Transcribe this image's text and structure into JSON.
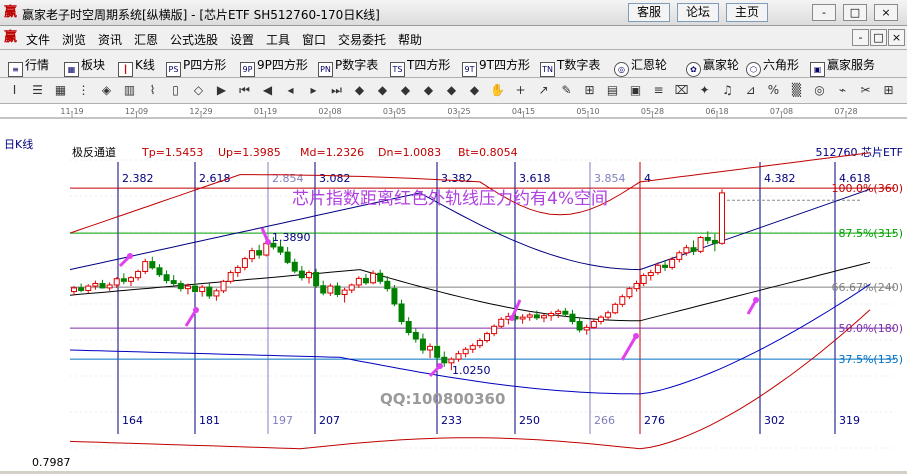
{
  "window": {
    "title": "赢家老子时空周期系统[纵横版] - [芯片ETF  SH512760-170日K线]",
    "buttons": [
      "客服",
      "论坛",
      "主页"
    ],
    "controls": [
      "-",
      "□",
      "×"
    ]
  },
  "menu": {
    "items": [
      "文件",
      "浏览",
      "资讯",
      "汇恩",
      "公式选股",
      "设置",
      "工具",
      "窗口",
      "交易委托",
      "帮助"
    ]
  },
  "toolbar1": {
    "items": [
      {
        "icon": "list-icon",
        "label": "行情"
      },
      {
        "icon": "blocks-icon",
        "label": "板块"
      },
      {
        "icon": "kline-icon",
        "label": "K线"
      },
      {
        "icon": "p-square-icon",
        "label": "P四方形"
      },
      {
        "icon": "9p-square-icon",
        "label": "9P四方形"
      },
      {
        "icon": "p-digit-icon",
        "label": "P数字表"
      },
      {
        "icon": "t-square-icon",
        "label": "T四方形"
      },
      {
        "icon": "9t-square-icon",
        "label": "9T四方形"
      },
      {
        "icon": "t-digit-icon",
        "label": "T数字表"
      },
      {
        "icon": "huien-wheel-icon",
        "label": "汇恩轮"
      },
      {
        "icon": "winner-wheel-icon",
        "label": "赢家轮"
      },
      {
        "icon": "hexagon-icon",
        "label": "六角形"
      },
      {
        "icon": "service-icon",
        "label": "赢家服务"
      }
    ]
  },
  "toolbar2": {
    "glyphs": [
      "Ⅰ",
      "☰",
      "▦",
      "⋮",
      "◈",
      "▥",
      "⌇",
      "▯",
      "◇",
      "▶",
      "⏮",
      "◀",
      "◂",
      "▸",
      "⏭",
      "◆",
      "◆",
      "◆",
      "◆",
      "◆",
      "◆",
      "✋",
      "+",
      "↗",
      "✎",
      "⊞",
      "▤",
      "▣",
      "≡",
      "⌧",
      "✦",
      "♫",
      "⊿",
      "%",
      "▒",
      "◎",
      "⌁",
      "✂",
      "⊞"
    ]
  },
  "chart_data": {
    "type": "candlestick",
    "panel_label": "日K线",
    "indicator_name": "极反通道",
    "stats": [
      {
        "label": "Tp",
        "value": "1.5453"
      },
      {
        "label": "Up",
        "value": "1.3985"
      },
      {
        "label": "Md",
        "value": "1.2326"
      },
      {
        "label": "Dn",
        "value": "1.0083"
      },
      {
        "label": "Bt",
        "value": "0.8054"
      }
    ],
    "symbol": "512760  芯片ETF",
    "date_ticks": [
      "11-19",
      "12-09",
      "12-29",
      "01-19",
      "02-08",
      "03-05",
      "03-25",
      "04-15",
      "05-10",
      "05-28",
      "06-18",
      "07-08",
      "07-28"
    ],
    "fib_top": [
      "2.382",
      "2.618",
      "2.854",
      "3.082",
      "3.382",
      "3.618",
      "3.854",
      "4",
      "4.382",
      "4.618"
    ],
    "cycle_bottom": [
      "164",
      "181",
      "197",
      "207",
      "233",
      "250",
      "266",
      "276",
      "302",
      "319"
    ],
    "levels": [
      {
        "label": "100.0%(360)",
        "price": 1.523,
        "color": "#c00000"
      },
      {
        "label": "87.5%(315)",
        "price": 1.4,
        "color": "#00a000"
      },
      {
        "label": "66.67%(240)",
        "price": 1.252,
        "color": "#808080"
      },
      {
        "label": "50.0%(180)",
        "price": 1.14,
        "color": "#7b2fa8"
      },
      {
        "label": "37.5%(135)",
        "price": 1.055,
        "color": "#0070c0"
      }
    ],
    "annotation": "芯片指数距离红色外轨线压力约有4%空间",
    "annotations_price": [
      {
        "text": "1.3890",
        "price": 1.389
      },
      {
        "text": "1.0250",
        "price": 1.025
      }
    ],
    "bottom_price": "0.7987",
    "watermark_contact": "QQ:100800360",
    "price_range": [
      0.79,
      1.6
    ],
    "candles": [
      [
        1.24,
        1.255,
        1.23,
        1.25
      ],
      [
        1.25,
        1.262,
        1.238,
        1.243
      ],
      [
        1.243,
        1.26,
        1.235,
        1.255
      ],
      [
        1.255,
        1.27,
        1.245,
        1.262
      ],
      [
        1.262,
        1.272,
        1.248,
        1.25
      ],
      [
        1.25,
        1.265,
        1.242,
        1.258
      ],
      [
        1.258,
        1.28,
        1.25,
        1.275
      ],
      [
        1.275,
        1.29,
        1.26,
        1.268
      ],
      [
        1.268,
        1.282,
        1.255,
        1.278
      ],
      [
        1.278,
        1.3,
        1.27,
        1.295
      ],
      [
        1.295,
        1.33,
        1.288,
        1.322
      ],
      [
        1.322,
        1.335,
        1.3,
        1.305
      ],
      [
        1.305,
        1.315,
        1.28,
        1.286
      ],
      [
        1.286,
        1.298,
        1.262,
        1.27
      ],
      [
        1.27,
        1.285,
        1.255,
        1.262
      ],
      [
        1.262,
        1.27,
        1.24,
        1.248
      ],
      [
        1.248,
        1.262,
        1.232,
        1.255
      ],
      [
        1.255,
        1.265,
        1.236,
        1.24
      ],
      [
        1.24,
        1.258,
        1.226,
        1.252
      ],
      [
        1.252,
        1.262,
        1.22,
        1.228
      ],
      [
        1.228,
        1.248,
        1.215,
        1.242
      ],
      [
        1.242,
        1.272,
        1.236,
        1.268
      ],
      [
        1.268,
        1.298,
        1.262,
        1.292
      ],
      [
        1.292,
        1.312,
        1.28,
        1.306
      ],
      [
        1.306,
        1.335,
        1.298,
        1.33
      ],
      [
        1.33,
        1.36,
        1.32,
        1.352
      ],
      [
        1.352,
        1.368,
        1.33,
        1.34
      ],
      [
        1.34,
        1.378,
        1.336,
        1.372
      ],
      [
        1.372,
        1.389,
        1.355,
        1.362
      ],
      [
        1.362,
        1.38,
        1.34,
        1.348
      ],
      [
        1.348,
        1.362,
        1.315,
        1.32
      ],
      [
        1.32,
        1.33,
        1.29,
        1.296
      ],
      [
        1.296,
        1.31,
        1.27,
        1.278
      ],
      [
        1.278,
        1.298,
        1.262,
        1.292
      ],
      [
        1.292,
        1.302,
        1.25,
        1.256
      ],
      [
        1.256,
        1.27,
        1.23,
        1.236
      ],
      [
        1.236,
        1.262,
        1.228,
        1.255
      ],
      [
        1.255,
        1.265,
        1.225,
        1.232
      ],
      [
        1.232,
        1.25,
        1.21,
        1.244
      ],
      [
        1.244,
        1.262,
        1.236,
        1.258
      ],
      [
        1.258,
        1.282,
        1.25,
        1.276
      ],
      [
        1.276,
        1.288,
        1.258,
        1.264
      ],
      [
        1.264,
        1.298,
        1.26,
        1.29
      ],
      [
        1.29,
        1.3,
        1.26,
        1.268
      ],
      [
        1.268,
        1.282,
        1.24,
        1.248
      ],
      [
        1.248,
        1.258,
        1.2,
        1.206
      ],
      [
        1.206,
        1.218,
        1.15,
        1.158
      ],
      [
        1.158,
        1.17,
        1.12,
        1.128
      ],
      [
        1.128,
        1.14,
        1.1,
        1.11
      ],
      [
        1.11,
        1.125,
        1.07,
        1.08
      ],
      [
        1.08,
        1.098,
        1.058,
        1.09
      ],
      [
        1.09,
        1.098,
        1.05,
        1.06
      ],
      [
        1.06,
        1.076,
        1.034,
        1.045
      ],
      [
        1.045,
        1.06,
        1.025,
        1.055
      ],
      [
        1.055,
        1.078,
        1.048,
        1.07
      ],
      [
        1.07,
        1.088,
        1.06,
        1.082
      ],
      [
        1.082,
        1.098,
        1.072,
        1.092
      ],
      [
        1.092,
        1.112,
        1.085,
        1.106
      ],
      [
        1.106,
        1.13,
        1.1,
        1.125
      ],
      [
        1.125,
        1.15,
        1.118,
        1.145
      ],
      [
        1.145,
        1.17,
        1.14,
        1.164
      ],
      [
        1.164,
        1.182,
        1.15,
        1.172
      ],
      [
        1.172,
        1.185,
        1.158,
        1.165
      ],
      [
        1.165,
        1.178,
        1.152,
        1.17
      ],
      [
        1.17,
        1.182,
        1.16,
        1.176
      ],
      [
        1.176,
        1.188,
        1.162,
        1.168
      ],
      [
        1.168,
        1.18,
        1.156,
        1.174
      ],
      [
        1.174,
        1.186,
        1.16,
        1.18
      ],
      [
        1.18,
        1.192,
        1.168,
        1.186
      ],
      [
        1.186,
        1.195,
        1.17,
        1.178
      ],
      [
        1.178,
        1.19,
        1.15,
        1.158
      ],
      [
        1.158,
        1.168,
        1.128,
        1.135
      ],
      [
        1.135,
        1.15,
        1.122,
        1.142
      ],
      [
        1.142,
        1.165,
        1.138,
        1.158
      ],
      [
        1.158,
        1.175,
        1.15,
        1.17
      ],
      [
        1.17,
        1.188,
        1.162,
        1.182
      ],
      [
        1.182,
        1.21,
        1.178,
        1.205
      ],
      [
        1.205,
        1.232,
        1.198,
        1.226
      ],
      [
        1.226,
        1.252,
        1.22,
        1.248
      ],
      [
        1.248,
        1.27,
        1.24,
        1.262
      ],
      [
        1.262,
        1.29,
        1.255,
        1.284
      ],
      [
        1.284,
        1.3,
        1.27,
        1.292
      ],
      [
        1.292,
        1.32,
        1.286,
        1.312
      ],
      [
        1.312,
        1.326,
        1.296,
        1.306
      ],
      [
        1.306,
        1.335,
        1.3,
        1.328
      ],
      [
        1.328,
        1.352,
        1.32,
        1.346
      ],
      [
        1.346,
        1.368,
        1.338,
        1.36
      ],
      [
        1.36,
        1.38,
        1.34,
        1.35
      ],
      [
        1.35,
        1.392,
        1.345,
        1.388
      ],
      [
        1.388,
        1.405,
        1.37,
        1.38
      ],
      [
        1.38,
        1.398,
        1.35,
        1.372
      ],
      [
        1.372,
        1.52,
        1.368,
        1.51
      ]
    ],
    "ma_mid": [
      1.222,
      1.23,
      1.24,
      1.252,
      1.262,
      1.27,
      1.277,
      1.282,
      1.285,
      1.286,
      1.285,
      1.282,
      1.277,
      1.27,
      1.262,
      1.252,
      1.242,
      1.232,
      1.222,
      1.212,
      1.202,
      1.194,
      1.186,
      1.178,
      1.171,
      1.165,
      1.161,
      1.158,
      1.158,
      1.16,
      1.164,
      1.17,
      1.178,
      1.188,
      1.2,
      1.214,
      1.23,
      1.248,
      1.268,
      1.29,
      1.312
    ]
  }
}
